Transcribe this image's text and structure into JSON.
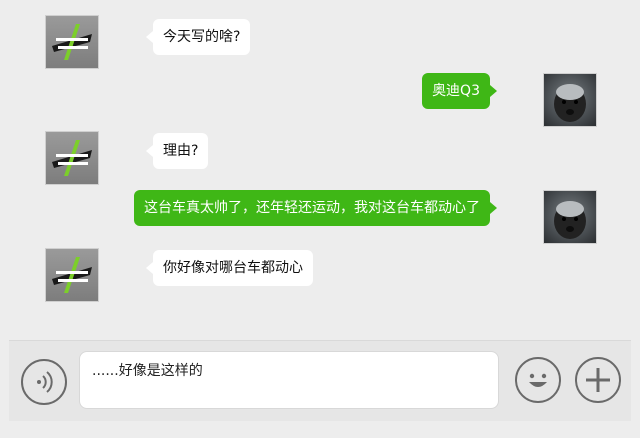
{
  "messages": [
    {
      "from": "other",
      "avatar": "brand-logo-avatar",
      "text": "今天写的啥?"
    },
    {
      "from": "me",
      "avatar": "honey-badger-avatar",
      "text": "奥迪Q3"
    },
    {
      "from": "other",
      "avatar": "brand-logo-avatar",
      "text": "理由?"
    },
    {
      "from": "me",
      "avatar": "honey-badger-avatar",
      "text": "这台车真太帅了，还年轻还运动，我对这台车都动心了"
    },
    {
      "from": "other",
      "avatar": "brand-logo-avatar",
      "text": "你好像对哪台车都动心"
    }
  ],
  "input": {
    "value": "......好像是这样的",
    "voice_icon": "voice-icon",
    "emoji_icon": "emoji-icon",
    "plus_icon": "plus-icon"
  },
  "colors": {
    "background": "#ededed",
    "outgoing_bubble": "#3fb716",
    "incoming_bubble": "#ffffff"
  }
}
